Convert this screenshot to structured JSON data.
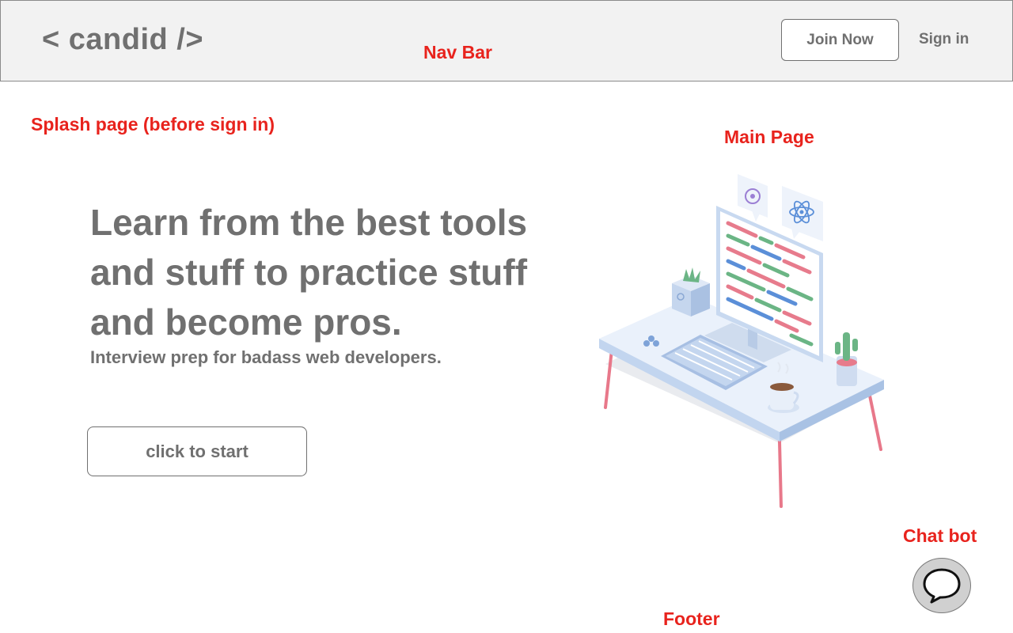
{
  "navbar": {
    "logo": "< candid />",
    "join_label": "Join Now",
    "signin_label": "Sign in"
  },
  "annotations": {
    "nav_bar": "Nav Bar",
    "splash": "Splash page (before sign in)",
    "main_page": "Main Page",
    "chat_bot": "Chat bot",
    "footer": "Footer"
  },
  "hero": {
    "title_lines": [
      "Learn from the best tools",
      "and stuff to practice stuff",
      "and become pros."
    ],
    "subtitle": "Interview prep for badass web developers.",
    "cta_label": "click to start"
  },
  "icons": {
    "illustration": "desk-workstation-illustration",
    "chat": "speech-bubble-icon"
  },
  "colors": {
    "text": "#707070",
    "annotation": "#e8231d",
    "navbar_bg": "#f2f2f2"
  }
}
